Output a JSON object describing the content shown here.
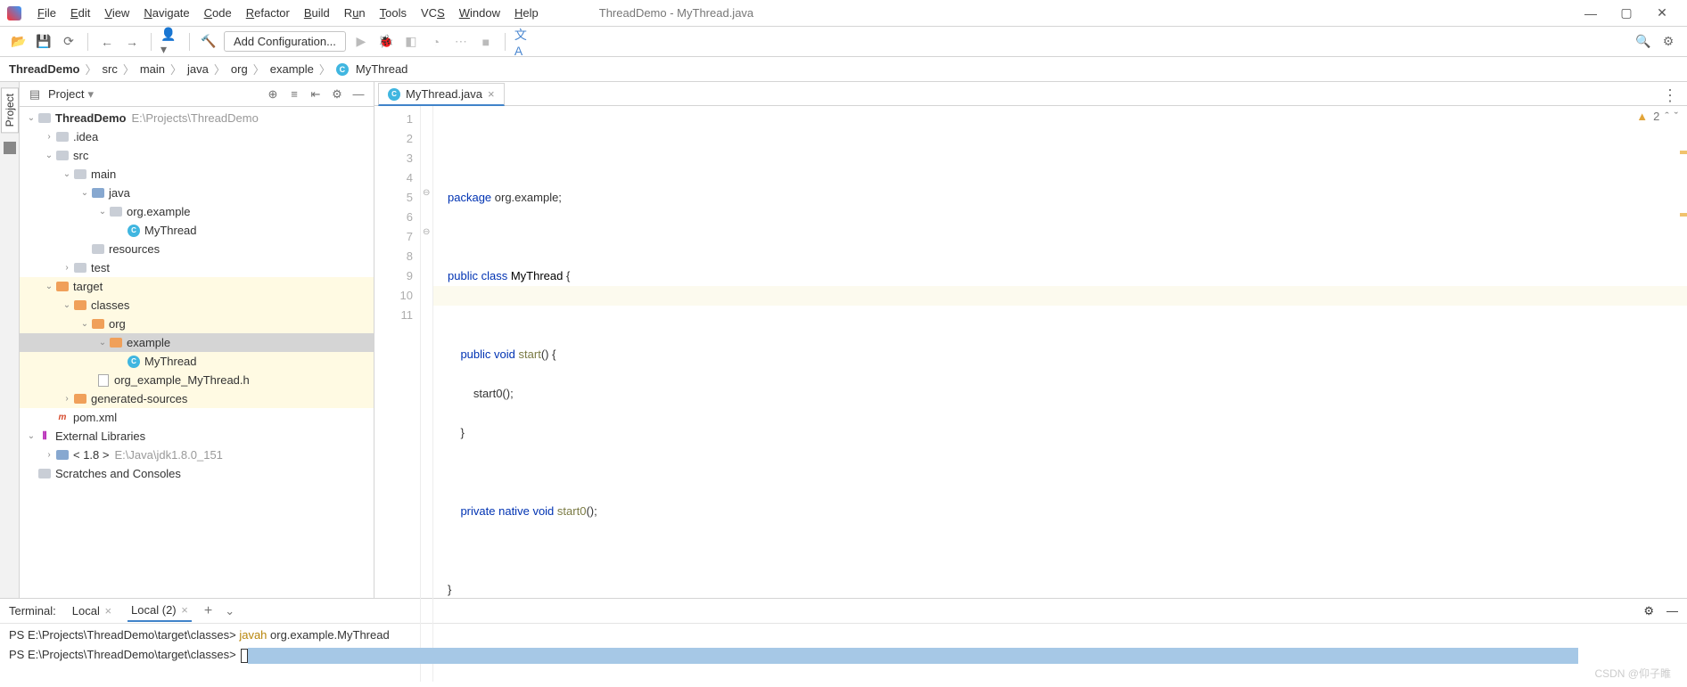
{
  "window": {
    "title": "ThreadDemo - MyThread.java"
  },
  "menu": {
    "file": "File",
    "edit": "Edit",
    "view": "View",
    "navigate": "Navigate",
    "code": "Code",
    "refactor": "Refactor",
    "build": "Build",
    "run": "Run",
    "tools": "Tools",
    "vcs": "VCS",
    "window": "Window",
    "help": "Help"
  },
  "toolbar": {
    "run_config": "Add Configuration..."
  },
  "breadcrumb": {
    "c0": "ThreadDemo",
    "c1": "src",
    "c2": "main",
    "c3": "java",
    "c4": "org",
    "c5": "example",
    "c6": "MyThread"
  },
  "panel": {
    "title": "Project"
  },
  "tree": {
    "root": {
      "label": "ThreadDemo",
      "hint": "E:\\Projects\\ThreadDemo"
    },
    "idea": ".idea",
    "src": "src",
    "main": "main",
    "java": "java",
    "pkg": "org.example",
    "cls1": "MyThread",
    "resources": "resources",
    "test": "test",
    "target": "target",
    "classes": "classes",
    "org": "org",
    "example": "example",
    "cls2": "MyThread",
    "header": "org_example_MyThread.h",
    "gensrc": "generated-sources",
    "pom": "pom.xml",
    "extlib": "External Libraries",
    "jdk": {
      "label": "< 1.8 >",
      "hint": "E:\\Java\\jdk1.8.0_151"
    },
    "scratch": "Scratches and Consoles"
  },
  "editor": {
    "tab": "MyThread.java",
    "warn_count": "2",
    "lines": {
      "l1": "1",
      "l2": "2",
      "l3": "3",
      "l4": "4",
      "l5": "5",
      "l6": "6",
      "l7": "7",
      "l8": "8",
      "l9": "9",
      "l10": "10",
      "l11": "11"
    },
    "code": {
      "pkg_kw": "package",
      "pkg_name": " org.example;",
      "pub": "public",
      "cls": "class",
      "cls_name": " MyThread ",
      "ob": "{",
      "void": "void",
      "start": "start",
      "start_call": "start0();",
      "cb": "}",
      "priv": "private",
      "native": "native",
      "start0": "start0",
      "paren": "();"
    }
  },
  "terminal": {
    "label": "Terminal:",
    "tab1": "Local",
    "tab2": "Local (2)",
    "prompt": "PS E:\\Projects\\ThreadDemo\\target\\classes>",
    "cmd": "javah",
    "arg": " org.example.MyThread"
  },
  "watermark": "CSDN @仰子睢"
}
